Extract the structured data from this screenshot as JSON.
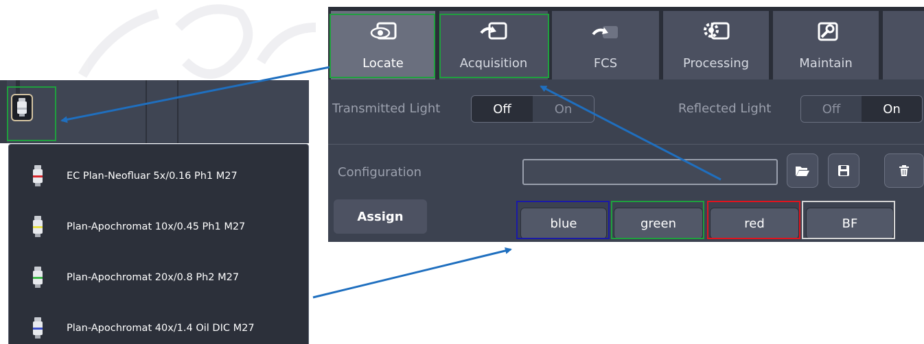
{
  "tabs": [
    {
      "label": "Locate",
      "icon": "eye-icon"
    },
    {
      "label": "Acquisition",
      "icon": "acquisition-icon"
    },
    {
      "label": "FCS",
      "icon": "fcs-icon"
    },
    {
      "label": "Processing",
      "icon": "gear-icon"
    },
    {
      "label": "Maintain",
      "icon": "wrench-icon"
    }
  ],
  "transmitted_light": {
    "label": "Transmitted Light",
    "off": "Off",
    "on": "On",
    "selected": "Off"
  },
  "reflected_light": {
    "label": "Reflected Light",
    "off": "Off",
    "on": "On",
    "selected": "On"
  },
  "configuration": {
    "label": "Configuration",
    "value": ""
  },
  "assign_label": "Assign",
  "channels": [
    {
      "label": "blue",
      "outline": "#1a1aa6"
    },
    {
      "label": "green",
      "outline": "#1fa03e"
    },
    {
      "label": "red",
      "outline": "#e0141e"
    },
    {
      "label": "BF",
      "outline": "#d4d4d4"
    }
  ],
  "objectives": [
    {
      "label": "EC Plan-Neofluar 5x/0.16 Ph1 M27",
      "band": "#d8262b"
    },
    {
      "label": "Plan-Apochromat 10x/0.45 Ph1 M27",
      "band": "#e8e04a"
    },
    {
      "label": "Plan-Apochromat 20x/0.8 Ph2 M27",
      "band": "#3fb94a"
    },
    {
      "label": "Plan-Apochromat 40x/1.4 Oil DIC M27",
      "band": "#3c4fc9"
    }
  ],
  "colors": {
    "highlight": "#1fa03e",
    "arrow": "#1f6fbf"
  }
}
